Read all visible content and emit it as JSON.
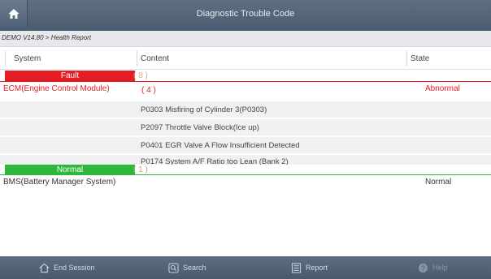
{
  "titlebar": {
    "title": "Diagnostic Trouble Code",
    "home_icon": "home-icon"
  },
  "breadcrumb": "DEMO V14.80 > Health Report",
  "columns": {
    "system": "System",
    "content": "Content",
    "state": "State"
  },
  "fault_group": {
    "label": "Fault",
    "count": "( 8 )",
    "color": "#e41c23"
  },
  "fault_systems": [
    {
      "name": "ECM(Engine Control Module)",
      "count": "( 4 )",
      "state": "Abnormal",
      "codes": [
        "P0303 Misfiring of Cylinder 3(P0303)",
        "P2097 Throttle Valve Block(Ice up)",
        "P0401 EGR Valve A Flow Insufficient Detected",
        "P0174 System A/F Ratio too Lean (Bank 2)"
      ]
    }
  ],
  "normal_group": {
    "label": "Normal",
    "count": "( 1 )",
    "color": "#2db83d"
  },
  "normal_systems": [
    {
      "name": "BMS(Battery Manager System)",
      "state": "Normal"
    }
  ],
  "bottom": {
    "end_session": "End Session",
    "search": "Search",
    "report": "Report",
    "help": "Help"
  }
}
